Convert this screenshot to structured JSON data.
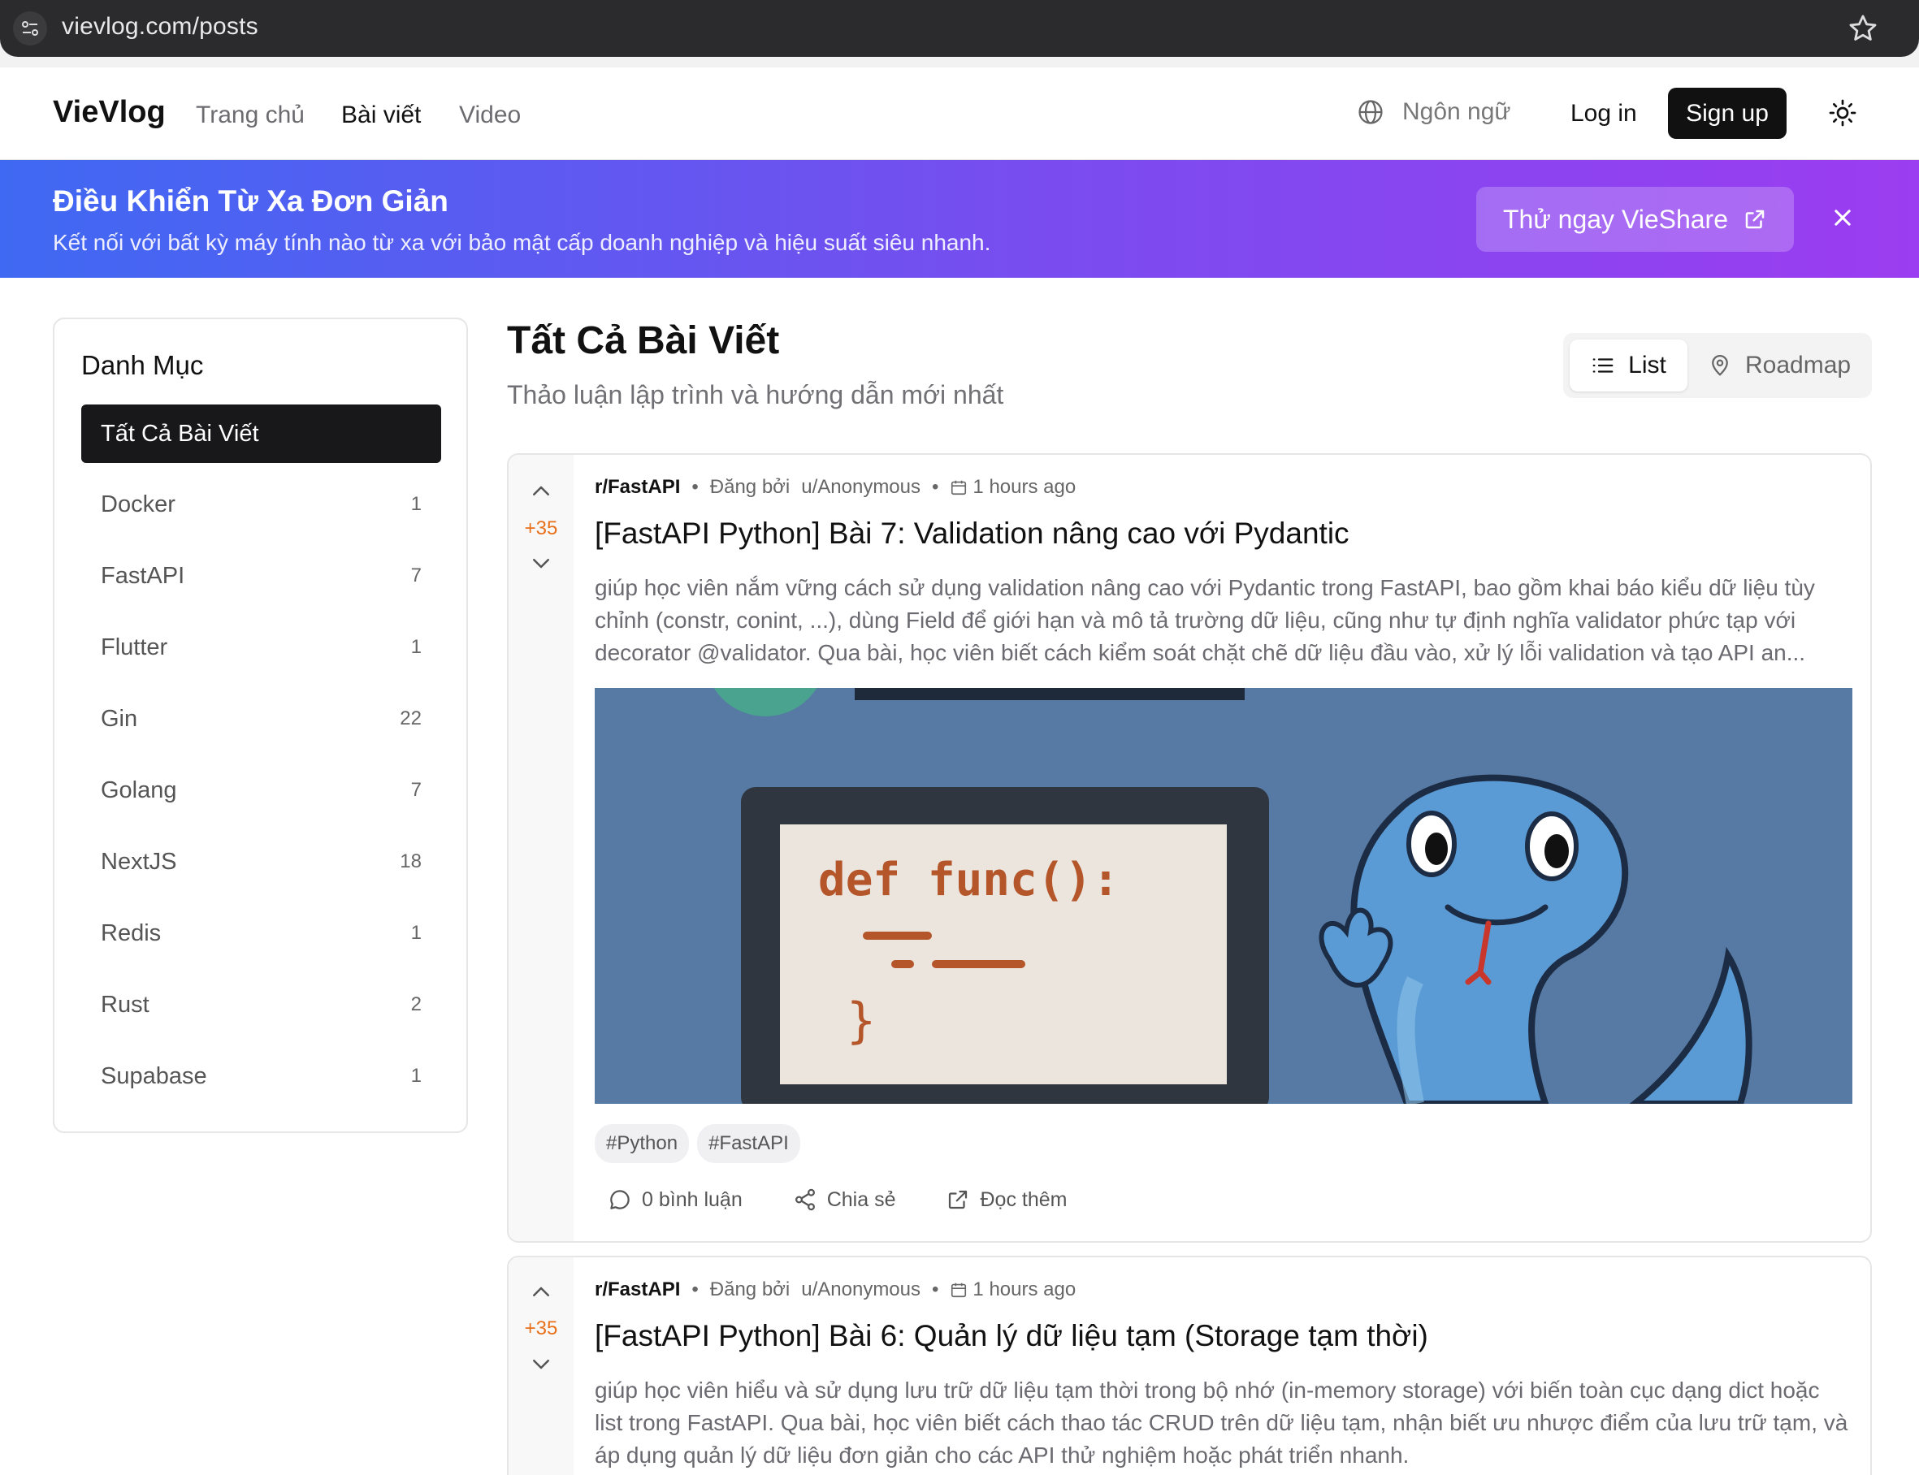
{
  "browser": {
    "url": "vievlog.com/posts"
  },
  "nav": {
    "brand": "VieVlog",
    "links": [
      "Trang chủ",
      "Bài viết",
      "Video"
    ],
    "language": "Ngôn ngữ",
    "login": "Log in",
    "signup": "Sign up"
  },
  "banner": {
    "title": "Điều Khiển Từ Xa Đơn Giản",
    "subtitle": "Kết nối với bất kỳ máy tính nào từ xa với bảo mật cấp doanh nghiệp và hiệu suất siêu nhanh.",
    "cta": "Thử ngay VieShare"
  },
  "sidebar": {
    "title": "Danh Mục",
    "active": "Tất Cả Bài Viết",
    "items": [
      {
        "label": "Docker",
        "count": "1"
      },
      {
        "label": "FastAPI",
        "count": "7"
      },
      {
        "label": "Flutter",
        "count": "1"
      },
      {
        "label": "Gin",
        "count": "22"
      },
      {
        "label": "Golang",
        "count": "7"
      },
      {
        "label": "NextJS",
        "count": "18"
      },
      {
        "label": "Redis",
        "count": "1"
      },
      {
        "label": "Rust",
        "count": "2"
      },
      {
        "label": "Supabase",
        "count": "1"
      }
    ]
  },
  "main": {
    "title": "Tất Cả Bài Viết",
    "subtitle": "Thảo luận lập trình và hướng dẫn mới nhất",
    "view_list": "List",
    "view_roadmap": "Roadmap"
  },
  "posts": [
    {
      "subreddit": "r/FastAPI",
      "posted_by": "Đăng bởi",
      "author": "u/Anonymous",
      "time": "1 hours ago",
      "votes": "+35",
      "title": "[FastAPI Python] Bài 7: Validation nâng cao với Pydantic",
      "excerpt": "giúp học viên nắm vững cách sử dụng validation nâng cao với Pydantic trong FastAPI, bao gồm khai báo kiểu dữ liệu tùy chỉnh (constr, conint, ...), dùng Field để giới hạn và mô tả trường dữ liệu, cũng như tự định nghĩa validator phức tạp với decorator @validator. Qua bài, học viên biết cách kiểm soát chặt chẽ dữ liệu đầu vào, xử lý lỗi validation và tạo API an...",
      "image_code": "def func():",
      "tags": [
        "#Python",
        "#FastAPI"
      ],
      "comments": "0 bình luận",
      "share": "Chia sẻ",
      "read_more": "Đọc thêm"
    },
    {
      "subreddit": "r/FastAPI",
      "posted_by": "Đăng bởi",
      "author": "u/Anonymous",
      "time": "1 hours ago",
      "votes": "+35",
      "title": "[FastAPI Python] Bài 6: Quản lý dữ liệu tạm (Storage tạm thời)",
      "excerpt": "giúp học viên hiểu và sử dụng lưu trữ dữ liệu tạm thời trong bộ nhớ (in-memory storage) với biến toàn cục dạng dict hoặc list trong FastAPI. Qua bài, học viên biết cách thao tác CRUD trên dữ liệu tạm, nhận biết ưu nhược điểm của lưu trữ tạm, và áp dụng quản lý dữ liệu đơn giản cho các API thử nghiệm hoặc phát triển nhanh."
    }
  ],
  "colors": {
    "banner_start": "#3f69f2",
    "banner_end": "#9b3df0",
    "vote": "#e8701a",
    "image_bg": "#567aa3",
    "snake": "#5b9bd5"
  }
}
